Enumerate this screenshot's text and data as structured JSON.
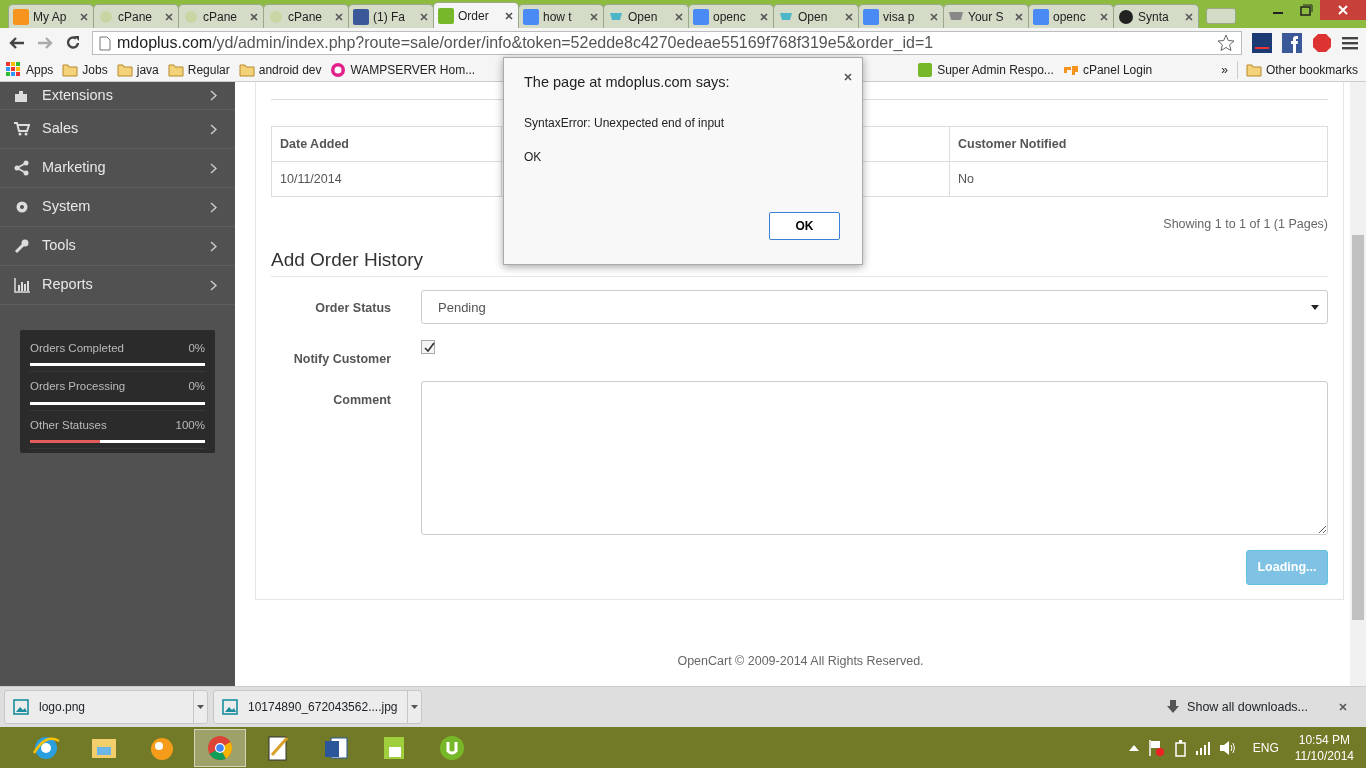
{
  "browser": {
    "tabs": [
      {
        "title": "My Ap",
        "selected": false
      },
      {
        "title": "cPane",
        "selected": false
      },
      {
        "title": "cPane",
        "selected": false
      },
      {
        "title": "cPane",
        "selected": false
      },
      {
        "title": "(1) Fa",
        "selected": false
      },
      {
        "title": "Order",
        "selected": true
      },
      {
        "title": "how t",
        "selected": false
      },
      {
        "title": "Open",
        "selected": false
      },
      {
        "title": "openc",
        "selected": false
      },
      {
        "title": "Open",
        "selected": false
      },
      {
        "title": "visa p",
        "selected": false
      },
      {
        "title": "Your S",
        "selected": false
      },
      {
        "title": "openc",
        "selected": false
      },
      {
        "title": "Synta",
        "selected": false
      }
    ],
    "address": {
      "host": "mdoplus.com",
      "path": "/yd/admin/index.php?route=sale/order/info&token=52edde8c4270edeae55169f768f319e5&order_id=1"
    },
    "bookmarks": [
      {
        "label": "Apps",
        "kind": "apps"
      },
      {
        "label": "Jobs",
        "kind": "folder"
      },
      {
        "label": "java",
        "kind": "folder"
      },
      {
        "label": "Regular",
        "kind": "folder"
      },
      {
        "label": "android dev",
        "kind": "folder"
      },
      {
        "label": "WAMPSERVER Hom...",
        "kind": "wamp"
      }
    ],
    "bookmarks_right": [
      {
        "label": "Super Admin Respo...",
        "kind": "utorrent"
      },
      {
        "label": "cPanel Login",
        "kind": "cpanel"
      }
    ],
    "overflow": "»",
    "other_bookmarks": "Other bookmarks"
  },
  "sidebar": {
    "items": [
      "Extensions",
      "Sales",
      "Marketing",
      "System",
      "Tools",
      "Reports"
    ]
  },
  "stats": [
    {
      "label": "Orders Completed",
      "reading": "0%",
      "level": 0
    },
    {
      "label": "Orders Processing",
      "reading": "0%",
      "level": 0
    },
    {
      "label": "Other Statuses",
      "reading": "100%",
      "level": 0.4
    }
  ],
  "history_table": {
    "columns": [
      "Date Added",
      "Customer Notified"
    ],
    "rows": [
      [
        "10/11/2014",
        "No"
      ]
    ]
  },
  "pagination": "Showing 1 to 1 of 1 (1 Pages)",
  "form": {
    "title": "Add Order History",
    "order_status": {
      "label": "Order Status",
      "value": "Pending"
    },
    "notify": {
      "label": "Notify Customer",
      "checked": true
    },
    "comment": {
      "label": "Comment"
    },
    "submit": {
      "label": "Loading...",
      "disabled": true
    }
  },
  "footer": {
    "link": "OpenCart",
    "text": "© 2009-2014 All Rights Reserved."
  },
  "dialog": {
    "title": "The page at mdoplus.com says:",
    "message": "SyntaxError: Unexpected end of input",
    "detail": "OK",
    "button": "OK"
  },
  "downloads": {
    "items": [
      "logo.png",
      "10174890_672043562....jpg"
    ],
    "show_all": "Show all downloads..."
  },
  "taskbar": {
    "apps": [
      {
        "selected": false
      },
      {
        "selected": false
      },
      {
        "selected": false
      },
      {
        "selected": true
      },
      {
        "selected": false
      },
      {
        "selected": false
      },
      {
        "selected": false
      },
      {
        "selected": false
      }
    ],
    "language": "ENG",
    "time": "10:54 PM",
    "date": "11/10/2014"
  }
}
